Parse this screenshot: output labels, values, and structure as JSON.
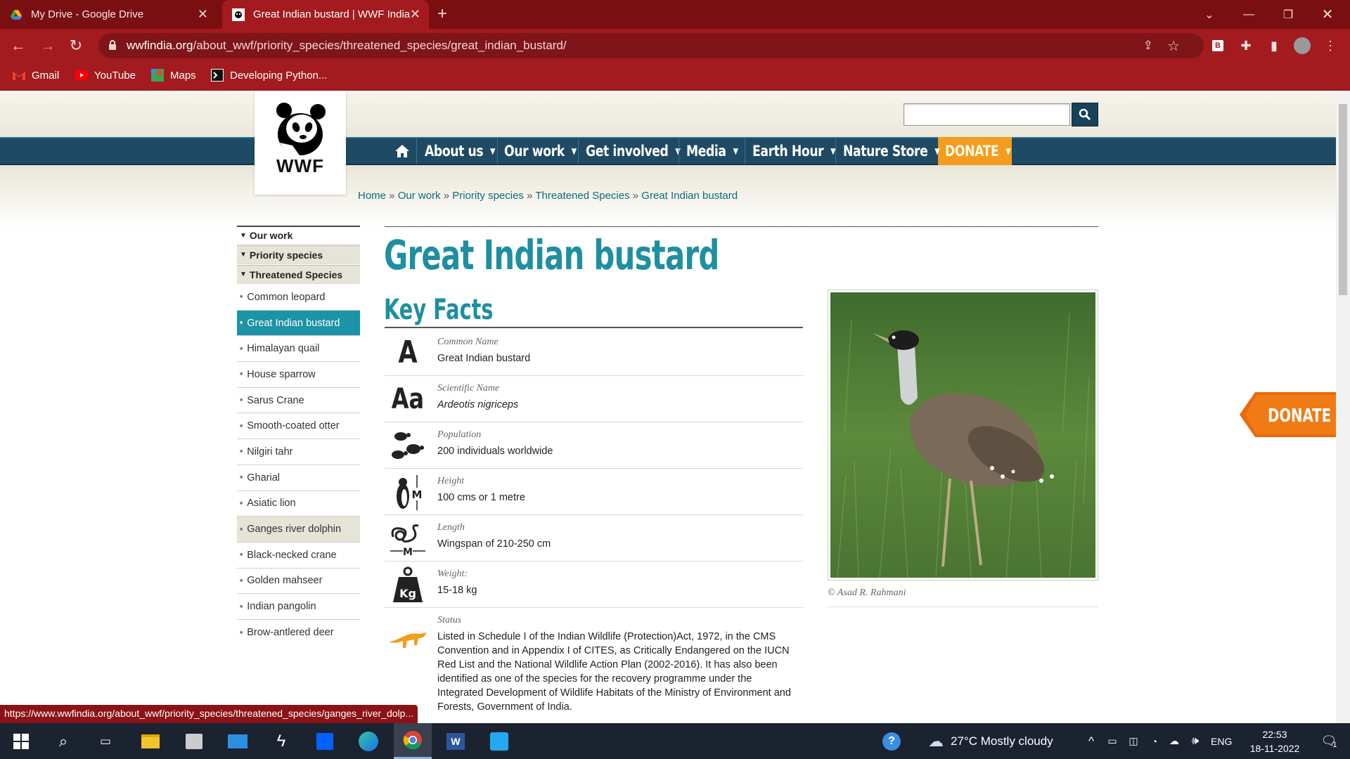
{
  "browser": {
    "tabs": [
      {
        "title": "My Drive - Google Drive",
        "active": false
      },
      {
        "title": "Great Indian bustard | WWF India",
        "active": true
      }
    ],
    "url_domain": "wwfindia.org",
    "url_path": "/about_wwf/priority_species/threatened_species/great_indian_bustard/",
    "bookmarks": [
      "Gmail",
      "YouTube",
      "Maps",
      "Developing Python..."
    ],
    "status_url": "https://www.wwfindia.org/about_wwf/priority_species/threatened_species/ganges_river_dolp..."
  },
  "site": {
    "logo_text": "WWF",
    "nav": [
      {
        "label": "About us",
        "arrow": "▼"
      },
      {
        "label": "Our work",
        "arrow": "▼"
      },
      {
        "label": "Get involved",
        "arrow": "▼"
      },
      {
        "label": "Media",
        "arrow": "▼"
      },
      {
        "label": "Earth Hour",
        "arrow": "▼"
      },
      {
        "label": "Nature Store",
        "arrow": "▼"
      },
      {
        "label": "DONATE",
        "arrow": "▼"
      }
    ],
    "breadcrumb": [
      "Home",
      "Our work",
      "Priority species",
      "Threatened Species",
      "Great Indian bustard"
    ],
    "breadcrumb_sep": " » ",
    "side_donate": "DONATE"
  },
  "sidebar": {
    "headers": [
      "Our work",
      "Priority species",
      "Threatened Species"
    ],
    "items": [
      "Common leopard",
      "Great Indian bustard",
      "Himalayan quail",
      "House sparrow",
      "Sarus Crane",
      "Smooth-coated otter",
      "Nilgiri tahr",
      "Gharial",
      "Asiatic lion",
      "Ganges river dolphin",
      "Black-necked crane",
      "Golden mahseer",
      "Indian pangolin",
      "Brow-antlered deer"
    ],
    "active_item": "Great Indian bustard",
    "hover_item": "Ganges river dolphin"
  },
  "main": {
    "title": "Great Indian bustard",
    "key_facts_heading": "Key Facts",
    "facts": [
      {
        "label": "Common Name",
        "value": "Great Indian bustard",
        "icon": "letter-a-icon"
      },
      {
        "label": "Scientific Name",
        "value": "Ardeotis nigriceps",
        "icon": "letters-aa-icon"
      },
      {
        "label": "Population",
        "value": "200 individuals worldwide",
        "icon": "turtles-icon"
      },
      {
        "label": "Height",
        "value": "100 cms or 1 metre",
        "icon": "penguin-height-icon"
      },
      {
        "label": "Length",
        "value": "Wingspan of 210-250 cm",
        "icon": "snake-length-icon"
      },
      {
        "label": "Weight:",
        "value": "15-18 kg",
        "icon": "kg-weight-icon"
      },
      {
        "label": "Status",
        "value": "Listed in Schedule I of the Indian Wildlife (Protection)Act, 1972, in the CMS Convention and in Appendix I of CITES, as Critically Endangered on the IUCN Red List and the National Wildlife Action Plan (2002-2016). It has also been identified as one of the species for the recovery programme under the Integrated Development of Wildlife Habitats of the Ministry of Environment and Forests, Government of India.",
        "icon": "dinosaur-status-icon"
      }
    ],
    "icon_letters": {
      "a": "A",
      "aa": "Aa",
      "m": "M",
      "kg": "Kg"
    },
    "photo_credit": "© Asad R. Rahmani"
  },
  "taskbar": {
    "weather": "27°C  Mostly cloudy",
    "lang": "ENG",
    "time": "22:53",
    "date": "18-11-2022",
    "notif_count": "1"
  },
  "colors": {
    "accent": "#1e8fa1",
    "nav": "#1e4a64",
    "donate": "#f39c1f",
    "chrome": "#a31b1f"
  }
}
